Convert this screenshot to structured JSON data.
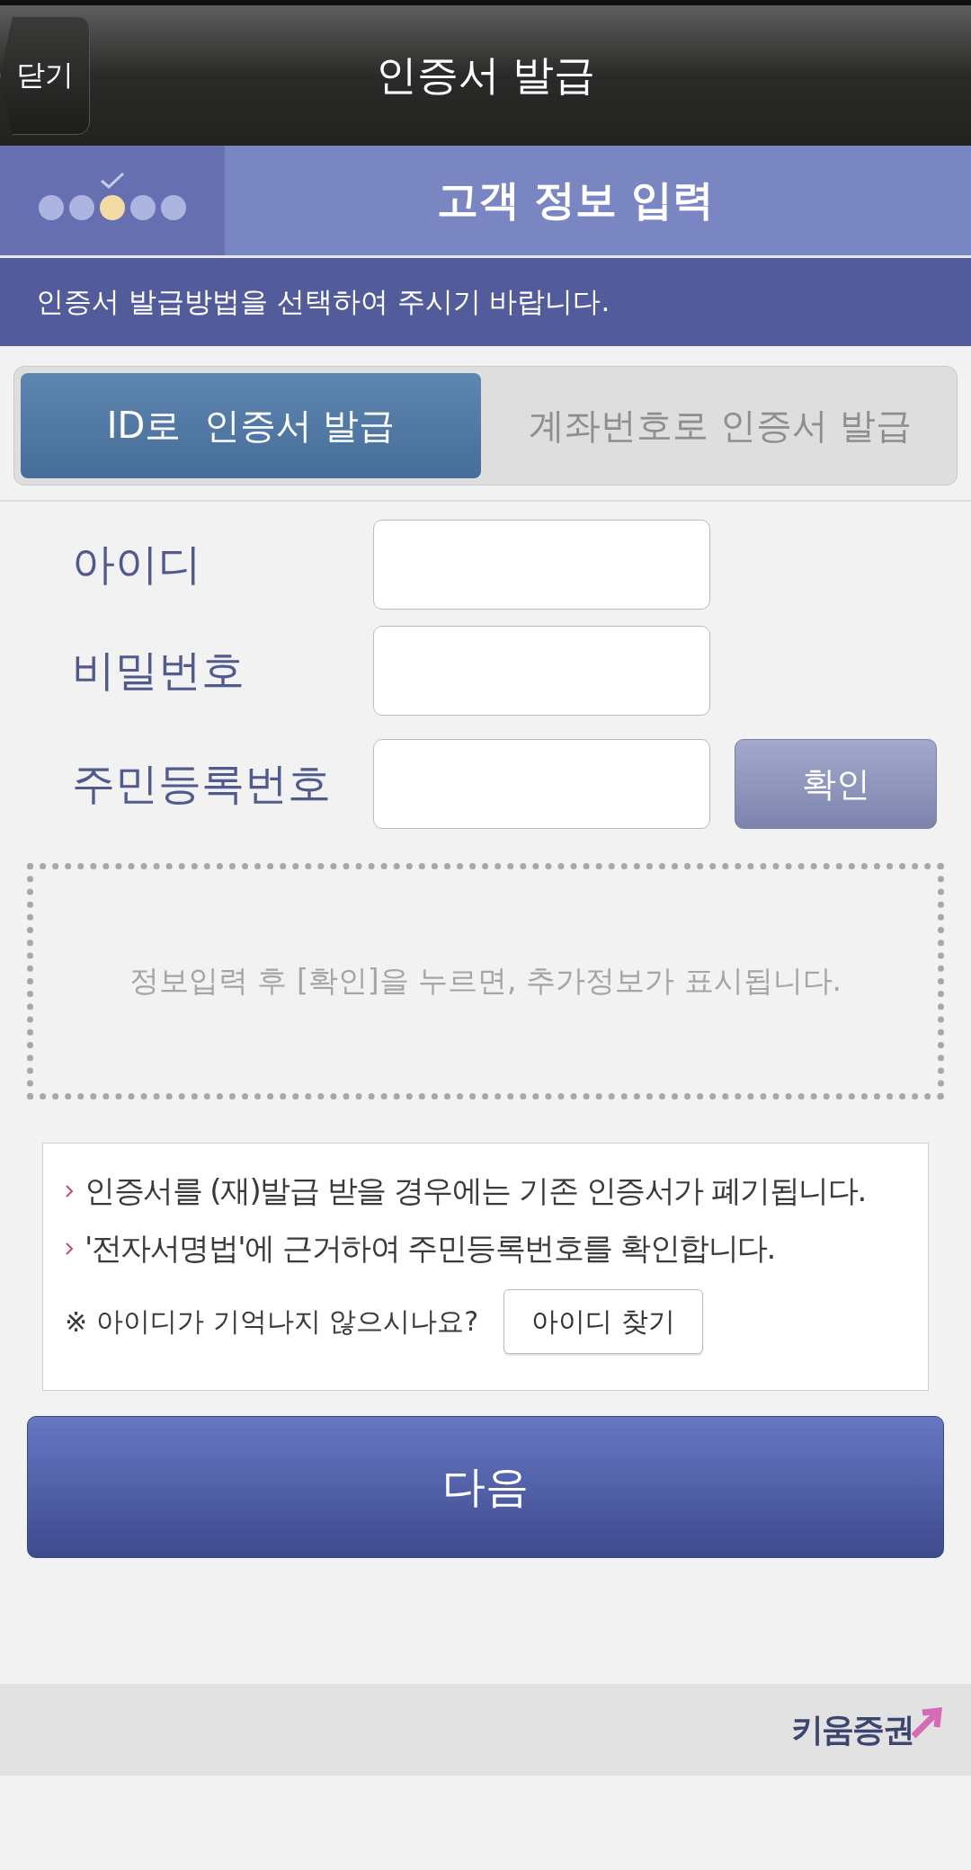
{
  "header": {
    "close_button": "닫기",
    "title": "인증서 발급"
  },
  "steps": {
    "items": [
      {
        "selected": false
      },
      {
        "selected": false
      },
      {
        "selected": true
      },
      {
        "selected": false
      },
      {
        "selected": false
      }
    ],
    "title": "고객 정보 입력"
  },
  "notice": "인증서 발급방법을 선택하여 주시기 바랍니다.",
  "tabs": [
    {
      "label": "ID로  인증서 발급",
      "selected": true
    },
    {
      "label": "계좌번호로 인증서 발급",
      "selected": false
    }
  ],
  "fields": [
    {
      "label": "아이디"
    },
    {
      "label": "비밀번호"
    },
    {
      "label": "주민등록번호",
      "button": "확인"
    }
  ],
  "result_hint": "정보입력 후 [확인]을 누르면, 추가정보가 표시됩니다.",
  "info": {
    "bullets": [
      "인증서를 (재)발급 받을 경우에는 기존 인증서가 폐기됩니다.",
      "'전자서명법'에 근거하여 주민등록번호를 확인합니다."
    ],
    "mark": "※",
    "question": "아이디가 기억나지 않으시나요?",
    "find_button": "아이디 찾기"
  },
  "next_button": "다음",
  "footer": {
    "logo": "키움증권"
  }
}
